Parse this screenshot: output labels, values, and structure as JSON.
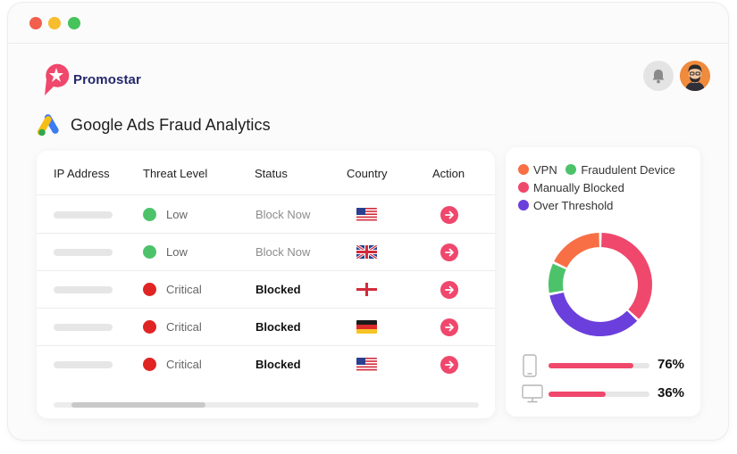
{
  "window": {
    "controls": [
      "close",
      "minimize",
      "maximize"
    ]
  },
  "brand": {
    "name": "Promostar",
    "logo_icon": "promostar-star-logo"
  },
  "header": {
    "notification_icon": "bell-icon",
    "avatar_icon": "user-avatar"
  },
  "page": {
    "title": "Google Ads Fraud Analytics",
    "title_icon": "google-ads-icon"
  },
  "table": {
    "columns": [
      "IP Address",
      "Threat Level",
      "Status",
      "Country",
      "Action"
    ],
    "rows": [
      {
        "threat": "Low",
        "threat_color": "#4cc36a",
        "status": "Block Now",
        "status_kind": "pending",
        "flag": "us-flag-icon"
      },
      {
        "threat": "Low",
        "threat_color": "#4cc36a",
        "status": "Block Now",
        "status_kind": "pending",
        "flag": "uk-flag-icon"
      },
      {
        "threat": "Critical",
        "threat_color": "#e02424",
        "status": "Blocked",
        "status_kind": "blocked",
        "flag": "england-flag-icon"
      },
      {
        "threat": "Critical",
        "threat_color": "#e02424",
        "status": "Blocked",
        "status_kind": "blocked",
        "flag": "germany-flag-icon"
      },
      {
        "threat": "Critical",
        "threat_color": "#e02424",
        "status": "Blocked",
        "status_kind": "blocked",
        "flag": "us-flag-icon"
      }
    ],
    "action_icon": "arrow-right-icon"
  },
  "chart_data": {
    "type": "pie",
    "labels": [
      "VPN",
      "Fraudulent Device",
      "Manually Blocked",
      "Over Threshold"
    ],
    "values": [
      18,
      10,
      37,
      35
    ],
    "colors": [
      "#f86f45",
      "#4cc36a",
      "#f0476c",
      "#6a3fdc"
    ]
  },
  "metrics": [
    {
      "icon": "smartphone-icon",
      "value": "76%",
      "fraction": 0.84
    },
    {
      "icon": "monitor-icon",
      "value": "36%",
      "fraction": 0.57
    }
  ],
  "colors": {
    "accent": "#f0476c",
    "brand_text": "#24286b"
  }
}
